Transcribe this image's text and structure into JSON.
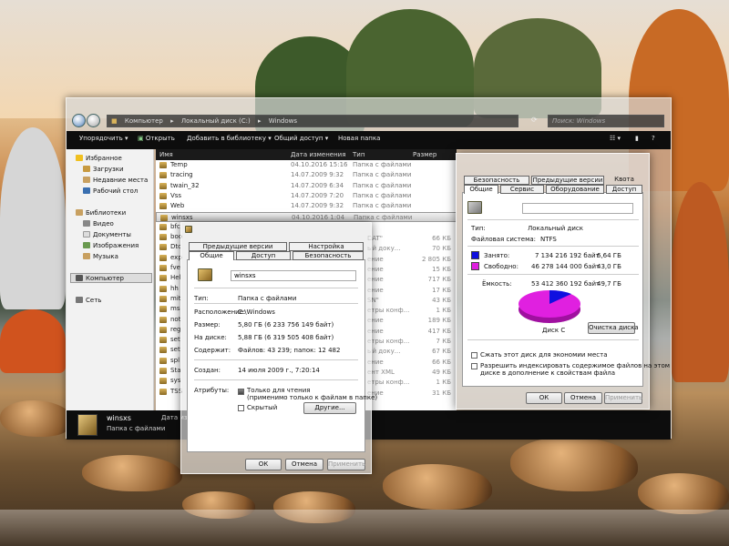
{
  "explorer": {
    "address": [
      "Компьютер",
      "Локальный диск (C:)",
      "Windows"
    ],
    "search_placeholder": "Поиск: Windows",
    "toolbar": {
      "organize": "Упорядочить ▾",
      "open": "Открыть",
      "add_to_library": "Добавить в библиотеку ▾",
      "share": "Общий доступ ▾",
      "new_folder": "Новая папка"
    },
    "nav": {
      "favorites": "Избранное",
      "downloads": "Загрузки",
      "recent": "Недавние места",
      "desktop": "Рабочий стол",
      "libraries": "Библиотеки",
      "video": "Видео",
      "documents": "Документы",
      "images": "Изображения",
      "music": "Музыка",
      "computer": "Компьютер",
      "network": "Сеть"
    },
    "columns": {
      "name": "Имя",
      "date": "Дата изменения",
      "type": "Тип",
      "size": "Размер"
    },
    "rows": [
      {
        "name": "Temp",
        "date": "04.10.2016 15:16",
        "type": "Папка с файлами"
      },
      {
        "name": "tracing",
        "date": "14.07.2009 9:32",
        "type": "Папка с файлами"
      },
      {
        "name": "twain_32",
        "date": "14.07.2009 6:34",
        "type": "Папка с файлами"
      },
      {
        "name": "Vss",
        "date": "14.07.2009 7:20",
        "type": "Папка с файлами"
      },
      {
        "name": "Web",
        "date": "14.07.2009 9:32",
        "type": "Папка с файлами"
      },
      {
        "name": "winsxs",
        "date": "04.10.2016 1:04",
        "type": "Папка с файлами"
      },
      {
        "name": "bfc",
        "date": "",
        "type": ""
      },
      {
        "name": "boo",
        "date": "",
        "type": ""
      },
      {
        "name": "Dtc",
        "date": "",
        "type": ""
      },
      {
        "name": "exp",
        "date": "",
        "type": ""
      },
      {
        "name": "fve",
        "date": "",
        "type": ""
      },
      {
        "name": "Hel",
        "date": "",
        "type": ""
      },
      {
        "name": "hh",
        "date": "",
        "type": ""
      },
      {
        "name": "mit",
        "date": "",
        "type": ""
      },
      {
        "name": "ms",
        "date": "",
        "type": ""
      },
      {
        "name": "not",
        "date": "",
        "type": ""
      },
      {
        "name": "reg",
        "date": "",
        "type": ""
      },
      {
        "name": "set",
        "date": "",
        "type": ""
      },
      {
        "name": "set",
        "date": "",
        "type": ""
      },
      {
        "name": "spl",
        "date": "",
        "type": ""
      },
      {
        "name": "Sta",
        "date": "",
        "type": ""
      },
      {
        "name": "sys",
        "date": "",
        "type": ""
      },
      {
        "name": "TSS",
        "date": "",
        "type": ""
      }
    ],
    "sizes": [
      {
        "type": "DAT\"",
        "size": "66 КБ"
      },
      {
        "type": "ый доку...",
        "size": "70 КБ"
      },
      {
        "type": "ение",
        "size": "2 805 КБ"
      },
      {
        "type": "ение",
        "size": "15 КБ"
      },
      {
        "type": "ение",
        "size": "717 КБ"
      },
      {
        "type": "ение",
        "size": "17 КБ"
      },
      {
        "type": "SN\"",
        "size": "43 КБ"
      },
      {
        "type": "етры конф...",
        "size": "1 КБ"
      },
      {
        "type": "ение",
        "size": "189 КБ"
      },
      {
        "type": "ение",
        "size": "417 КБ"
      },
      {
        "type": "етры конф...",
        "size": "7 КБ"
      },
      {
        "type": "ый доку...",
        "size": "67 КБ"
      },
      {
        "type": "ение",
        "size": "66 КБ"
      },
      {
        "type": "ент XML",
        "size": "49 КБ"
      },
      {
        "type": "етры конф...",
        "size": "1 КБ"
      },
      {
        "type": "ение",
        "size": "31 КБ"
      }
    ],
    "details": {
      "name": "winsxs",
      "type": "Папка с файлами",
      "date_label": "Дата из"
    }
  },
  "folder_props": {
    "tabs": {
      "previous": "Предыдущие версии",
      "settings": "Настройка",
      "general": "Общие",
      "access": "Доступ",
      "security": "Безопасность"
    },
    "name": "winsxs",
    "type_label": "Тип:",
    "type_value": "Папка с файлами",
    "location_label": "Расположение:",
    "location_value": "C:\\Windows",
    "size_label": "Размер:",
    "size_value": "5,80 ГБ (6 233 756 149 байт)",
    "disk_label": "На диске:",
    "disk_value": "5,88 ГБ (6 319 505 408 байт)",
    "contains_label": "Содержит:",
    "contains_value": "Файлов: 43 239; папок: 12 482",
    "created_label": "Создан:",
    "created_value": "14 июля 2009 г., 7:20:14",
    "attrs_label": "Атрибуты:",
    "readonly": "Только для чтения",
    "readonly_note": "(применимо только к файлам в папке)",
    "hidden": "Скрытый",
    "other_button": "Другие...",
    "ok": "ОК",
    "cancel": "Отмена",
    "apply": "Применить"
  },
  "disk_props": {
    "tabs": {
      "security": "Безопасность",
      "previous": "Предыдущие версии",
      "quota": "Квота",
      "general": "Общие",
      "service": "Сервис",
      "hardware": "Оборудование",
      "access": "Доступ"
    },
    "type_label": "Тип:",
    "type_value": "Локальный диск",
    "fs_label": "Файловая система:",
    "fs_value": "NTFS",
    "used_label": "Занято:",
    "used_bytes": "7 134 216 192 байт",
    "used_gb": "6,64 ГБ",
    "free_label": "Свободно:",
    "free_bytes": "46 278 144 000 байт",
    "free_gb": "43,0 ГБ",
    "capacity_label": "Ёмкость:",
    "capacity_bytes": "53 412 360 192 байт",
    "capacity_gb": "49,7 ГБ",
    "disk_name": "Диск C",
    "cleanup_button": "Очистка диска",
    "compress": "Сжать этот диск для экономии места",
    "index": "Разрешить индексировать содержимое файлов на этом",
    "index2": "диске в дополнение к свойствам файла",
    "ok": "ОК",
    "cancel": "Отмена",
    "apply": "Применить",
    "colors": {
      "used": "#1010e0",
      "free": "#e020e0"
    }
  }
}
